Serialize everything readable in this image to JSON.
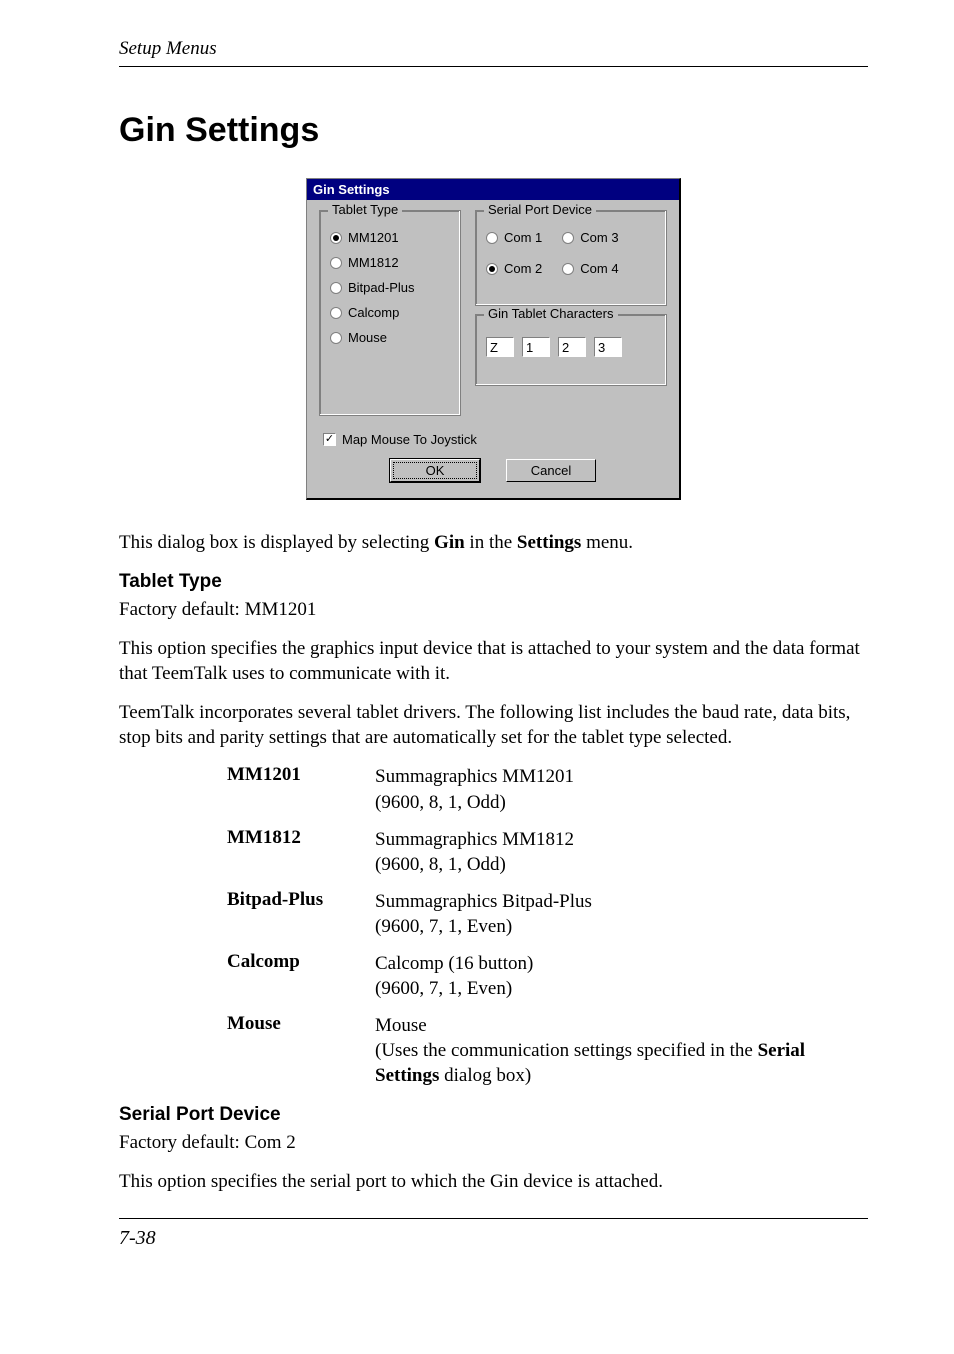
{
  "running_head": "Setup Menus",
  "h1": "Gin Settings",
  "dialog": {
    "title": "Gin Settings",
    "tablet_type": {
      "legend": "Tablet Type",
      "options": [
        {
          "label": "MM1201",
          "selected": true,
          "disabled": false
        },
        {
          "label": "MM1812",
          "selected": false,
          "disabled": false
        },
        {
          "label": "Bitpad-Plus",
          "selected": false,
          "disabled": false
        },
        {
          "label": "Calcomp",
          "selected": false,
          "disabled": false
        },
        {
          "label": "Mouse",
          "selected": false,
          "disabled": false
        }
      ]
    },
    "serial_port": {
      "legend": "Serial Port Device",
      "options": [
        {
          "label": "Com 1",
          "selected": false
        },
        {
          "label": "Com 3",
          "selected": false
        },
        {
          "label": "Com 2",
          "selected": true
        },
        {
          "label": "Com 4",
          "selected": false
        }
      ]
    },
    "gin_chars": {
      "legend": "Gin Tablet Characters",
      "values": [
        "Z",
        "1",
        "2",
        "3"
      ]
    },
    "map_mouse": {
      "label": "Map Mouse To Joystick",
      "checked": true
    },
    "ok": "OK",
    "cancel": "Cancel"
  },
  "intro": {
    "p1a": "This dialog box is displayed by selecting ",
    "p1b": "Gin",
    "p1c": " in the ",
    "p1d": "Settings",
    "p1e": " menu."
  },
  "tablet_type_section": {
    "heading": "Tablet Type",
    "default_line": "Factory default: MM1201",
    "p1": "This option specifies the graphics input device that is attached to your system and the data format that TeemTalk uses to communicate with it.",
    "p2": "TeemTalk incorporates several tablet drivers. The following list includes the baud rate, data bits, stop bits and parity settings that are automatically set for the tablet type selected.",
    "list": [
      {
        "name": "MM1201",
        "line1": "Summagraphics MM1201",
        "line2": "(9600, 8, 1, Odd)"
      },
      {
        "name": "MM1812",
        "line1": "Summagraphics MM1812",
        "line2": "(9600, 8, 1, Odd)"
      },
      {
        "name": "Bitpad-Plus",
        "line1": "Summagraphics Bitpad-Plus",
        "line2": "(9600, 7, 1, Even)"
      },
      {
        "name": "Calcomp",
        "line1": "Calcomp (16 button)",
        "line2": "(9600, 7, 1, Even)"
      }
    ],
    "mouse": {
      "name": "Mouse",
      "line1": "Mouse",
      "line2a": "(Uses the communication settings specified in the ",
      "line2b": "Serial Settings",
      "line2c": " dialog box)"
    }
  },
  "serial_port_section": {
    "heading": "Serial Port Device",
    "default_line": "Factory default: Com 2",
    "p1": "This option specifies the serial port to which the Gin device is attached."
  },
  "page_num": "7-38"
}
